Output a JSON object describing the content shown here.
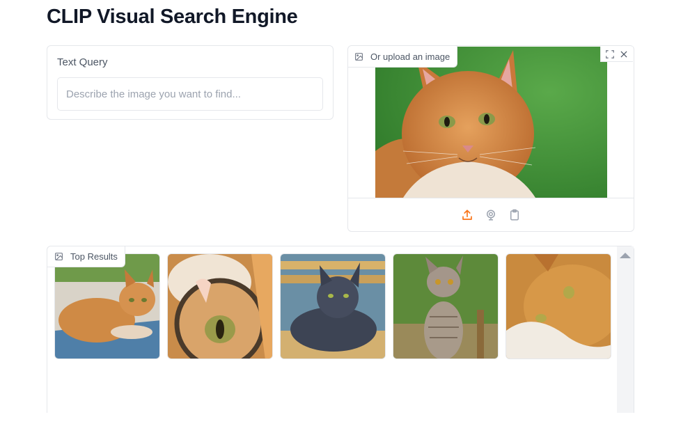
{
  "app": {
    "title": "CLIP Visual Search Engine"
  },
  "text_query": {
    "label": "Text Query",
    "placeholder": "Describe the image you want to find...",
    "value": ""
  },
  "image_input": {
    "label": "Or upload an image",
    "label_icon": "image-icon",
    "tools": [
      "fullscreen-icon",
      "close-icon"
    ],
    "sources": [
      "upload-icon",
      "webcam-icon",
      "clipboard-icon"
    ],
    "accent_color": "#f97316"
  },
  "gallery": {
    "label": "Top Results",
    "label_icon": "image-icon",
    "results": [
      {
        "name": "ginger-cat-lying-on-table"
      },
      {
        "name": "cat-behind-magnifying-glass"
      },
      {
        "name": "gray-cat-on-bench"
      },
      {
        "name": "tabby-cat-sitting"
      },
      {
        "name": "ginger-cat-on-blanket"
      }
    ]
  }
}
